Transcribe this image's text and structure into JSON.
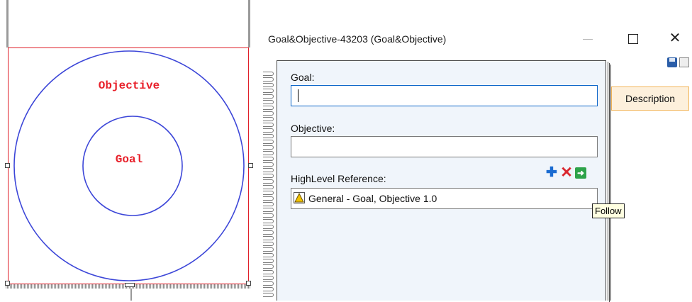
{
  "diagram": {
    "outer_label": "Objective",
    "inner_label": "Goal"
  },
  "window": {
    "title": "Goal&Objective-43203 (Goal&Objective)",
    "minimize_glyph": "—",
    "close_glyph": "✕"
  },
  "form": {
    "goal_label": "Goal:",
    "goal_value": "",
    "objective_label": "Objective:",
    "objective_value": "",
    "highlevel_label": "HighLevel Reference:",
    "reference_item": "General - Goal, Objective 1.0"
  },
  "actions": {
    "add_glyph": "✚",
    "remove_glyph": "✕",
    "follow_glyph": "➜",
    "follow_tooltip": "Follow"
  },
  "side_tabs": {
    "description": "Description"
  },
  "colors": {
    "diagram_text": "#e8202a",
    "circle_stroke": "#3c46d8",
    "frame": "#e0202a",
    "add": "#1a6bd1",
    "remove": "#d9262e",
    "follow": "#2ea34a"
  }
}
